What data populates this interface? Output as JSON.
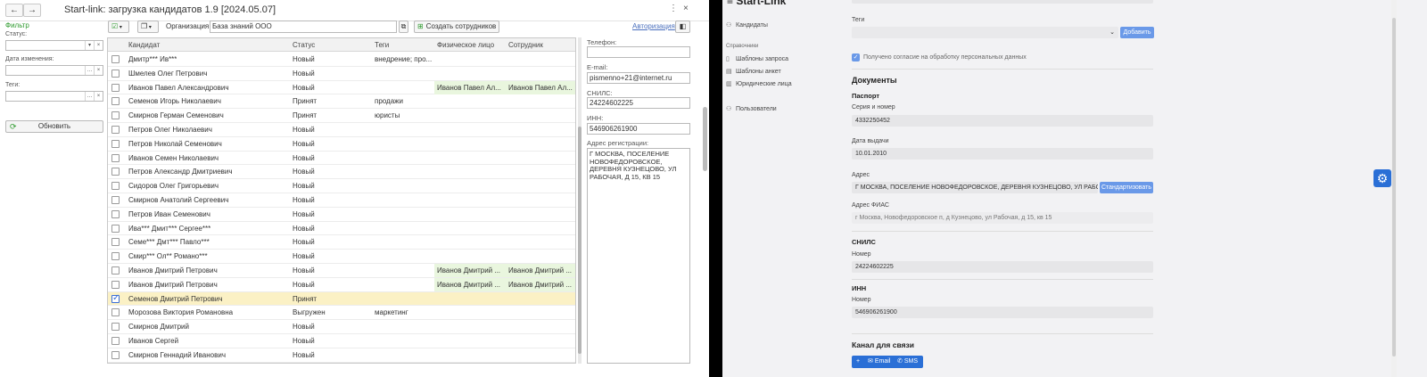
{
  "window": {
    "title": "Start-link: загрузка кандидатов 1.9 [2024.05.07]",
    "back_icon": "←",
    "forward_icon": "→",
    "more_icon": "⋮",
    "close_icon": "×"
  },
  "filter": {
    "title": "Фильтр",
    "status_label": "Статус:",
    "date_label": "Дата изменения:",
    "tags_label": "Теги:",
    "refresh_label": "Обновить"
  },
  "toolbar": {
    "org_label": "Организация:",
    "org_value": "База знаний ООО",
    "create_employees_label": "Создать сотрудников",
    "auth_link": "Авторизация"
  },
  "table": {
    "columns": [
      "Кандидат",
      "Статус",
      "Теги",
      "Физическое лицо",
      "Сотрудник"
    ],
    "rows": [
      {
        "name": "Дмитр*** Ив***",
        "status": "Новый",
        "tags": "внедрение; про...",
        "person": "",
        "employee": "",
        "checked": false
      },
      {
        "name": "Шмелев Олег Петрович",
        "status": "Новый",
        "tags": "",
        "person": "",
        "employee": "",
        "checked": false
      },
      {
        "name": "Иванов Павел Александрович",
        "status": "Новый",
        "tags": "",
        "person": "Иванов Павел Ал...",
        "employee": "Иванов Павел Ал...",
        "checked": false
      },
      {
        "name": "Семенов Игорь Николаевич",
        "status": "Принят",
        "tags": "продажи",
        "person": "",
        "employee": "",
        "checked": false
      },
      {
        "name": "Смирнов Герман Семенович",
        "status": "Принят",
        "tags": "юристы",
        "person": "",
        "employee": "",
        "checked": false
      },
      {
        "name": "Петров Олег Николаевич",
        "status": "Новый",
        "tags": "",
        "person": "",
        "employee": "",
        "checked": false
      },
      {
        "name": "Петров Николай Семенович",
        "status": "Новый",
        "tags": "",
        "person": "",
        "employee": "",
        "checked": false
      },
      {
        "name": "Иванов Семен Николаевич",
        "status": "Новый",
        "tags": "",
        "person": "",
        "employee": "",
        "checked": false
      },
      {
        "name": "Петров Александр Дмитриевич",
        "status": "Новый",
        "tags": "",
        "person": "",
        "employee": "",
        "checked": false
      },
      {
        "name": "Сидоров Олег Григорьевич",
        "status": "Новый",
        "tags": "",
        "person": "",
        "employee": "",
        "checked": false
      },
      {
        "name": "Смирнов Анатолий Сергеевич",
        "status": "Новый",
        "tags": "",
        "person": "",
        "employee": "",
        "checked": false
      },
      {
        "name": "Петров Иван Семенович",
        "status": "Новый",
        "tags": "",
        "person": "",
        "employee": "",
        "checked": false
      },
      {
        "name": "Ива*** Дмит*** Сергее***",
        "status": "Новый",
        "tags": "",
        "person": "",
        "employee": "",
        "checked": false
      },
      {
        "name": "Семе*** Дмт*** Павло***",
        "status": "Новый",
        "tags": "",
        "person": "",
        "employee": "",
        "checked": false
      },
      {
        "name": "Смир*** Ол** Романо***",
        "status": "Новый",
        "tags": "",
        "person": "",
        "employee": "",
        "checked": false
      },
      {
        "name": "Иванов Дмитрий Петрович",
        "status": "Новый",
        "tags": "",
        "person": "Иванов Дмитрий ...",
        "employee": "Иванов Дмитрий ...",
        "checked": false
      },
      {
        "name": "Иванов Дмитрий Петрович",
        "status": "Новый",
        "tags": "",
        "person": "Иванов Дмитрий ...",
        "employee": "Иванов Дмитрий ...",
        "checked": false
      },
      {
        "name": "Семенов Дмитрий Петрович",
        "status": "Принят",
        "tags": "",
        "person": "",
        "employee": "",
        "checked": true
      },
      {
        "name": "Морозова Виктория Романовна",
        "status": "Выгружен",
        "tags": "маркетинг",
        "person": "",
        "employee": "",
        "checked": false
      },
      {
        "name": "Смирнов Дмитрий",
        "status": "Новый",
        "tags": "",
        "person": "",
        "employee": "",
        "checked": false
      },
      {
        "name": "Иванов Сергей",
        "status": "Новый",
        "tags": "",
        "person": "",
        "employee": "",
        "checked": false
      },
      {
        "name": "Смирнов Геннадий Иванович",
        "status": "Новый",
        "tags": "",
        "person": "",
        "employee": "",
        "checked": false
      }
    ]
  },
  "details": {
    "phone_label": "Телефон:",
    "phone_value": "",
    "email_label": "E-mail:",
    "email_value": "pismenno+21@internet.ru",
    "snils_label": "СНИЛС:",
    "snils_value": "24224602225",
    "inn_label": "ИНН:",
    "inn_value": "546906261900",
    "address_label": "Адрес регистрации:",
    "address_value": "Г МОСКВА, ПОСЕЛЕНИЕ НОВОФЕДОРОВСКОЕ, ДЕРЕВНЯ КУЗНЕЦОВО, УЛ РАБОЧАЯ, Д 15, КВ 15"
  },
  "web": {
    "app_title": "Start-Link",
    "nav": {
      "candidates": "Кандидаты",
      "reference_section": "Справочники",
      "request_templates": "Шаблоны запроса",
      "survey_templates": "Шаблоны анкет",
      "legal_entities": "Юридические лица",
      "users": "Пользователи"
    },
    "tags_label": "Теги",
    "add_button": "Добавить",
    "consent_label": "Получено согласие на обработку персональных данных",
    "documents_title": "Документы",
    "passport_title": "Паспорт",
    "series_label": "Серия и номер",
    "series_value": "4332250452",
    "issue_date_label": "Дата выдачи",
    "issue_date_value": "10.01.2010",
    "address_label": "Адрес",
    "address_value": "Г МОСКВА, ПОСЕЛЕНИЕ НОВОФЕДОРОВСКОЕ, ДЕРЕВНЯ КУЗНЕЦОВО, УЛ РАБОЧАЯ",
    "standardize_button": "Стандартизовать",
    "fias_label": "Адрес ФИАС",
    "fias_value": "г Москва, Новофедоровское п, д Кузнецово, ул Рабочая, д 15, кв 15",
    "snils_title": "СНИЛС",
    "snils_number_label": "Номер",
    "snils_value": "24224602225",
    "inn_title": "ИНН",
    "inn_number_label": "Номер",
    "inn_value": "546906261900",
    "contact_title": "Канал для связи",
    "contact_add": "+",
    "contact_email": "Email",
    "contact_sms": "SMS"
  }
}
